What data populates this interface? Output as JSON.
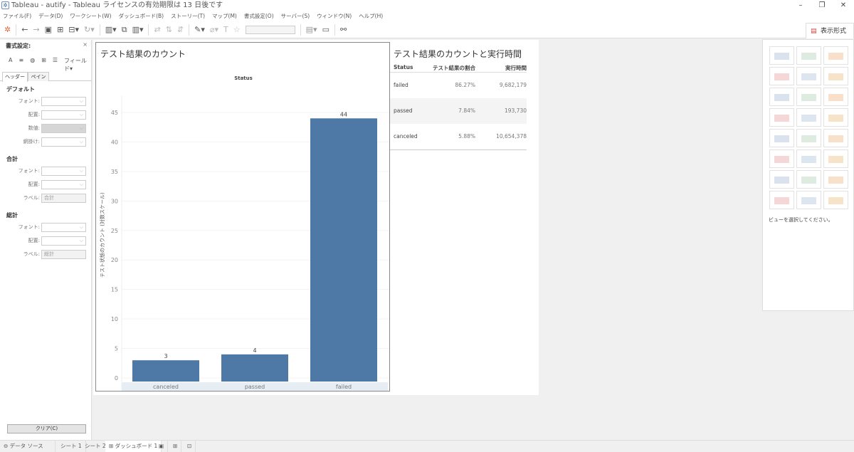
{
  "window": {
    "title": "Tableau - autify - Tableau ライセンスの有効期限は 13 日後です",
    "controls": [
      "–",
      "❐",
      "✕"
    ]
  },
  "menu": [
    "ファイル(F)",
    "データ(D)",
    "ワークシート(W)",
    "ダッシュボード(B)",
    "ストーリー(T)",
    "マップ(M)",
    "書式設定(O)",
    "サーバー(S)",
    "ウィンドウ(N)",
    "ヘルプ(H)"
  ],
  "format_panel": {
    "title": "書式設定:",
    "close": "×",
    "field_menu": "フィールド▾",
    "tabs": [
      "ヘッダー",
      "ペイン"
    ],
    "sections": [
      {
        "title": "デフォルト",
        "rows": [
          {
            "label": "フォント:",
            "value": ""
          },
          {
            "label": "配置:",
            "value": ""
          },
          {
            "label": "数値:",
            "value": ""
          },
          {
            "label": "網掛け:",
            "value": ""
          }
        ]
      },
      {
        "title": "合計",
        "rows": [
          {
            "label": "フォント:",
            "value": ""
          },
          {
            "label": "配置:",
            "value": ""
          },
          {
            "label": "ラベル:",
            "value": "合計"
          }
        ]
      },
      {
        "title": "総計",
        "rows": [
          {
            "label": "フォント:",
            "value": ""
          },
          {
            "label": "配置:",
            "value": ""
          },
          {
            "label": "ラベル:",
            "value": "総計"
          }
        ]
      }
    ],
    "clear_button": "クリア(C)"
  },
  "chart_data": {
    "type": "bar",
    "title": "テスト結果のカウント",
    "column_header": "Status",
    "categories": [
      "canceled",
      "passed",
      "failed"
    ],
    "values": [
      3,
      4,
      44
    ],
    "ylabel": "テスト状態のカウント (対数スケール)",
    "yticks": [
      0,
      5,
      10,
      15,
      20,
      25,
      30,
      35,
      40,
      45
    ],
    "ylim": [
      0,
      45
    ],
    "bar_color": "#4e79a7"
  },
  "table": {
    "title": "テスト結果のカウントと実行時間",
    "headers": [
      "Status",
      "テスト結果の割合",
      "実行時間"
    ],
    "rows": [
      [
        "failed",
        "86.27%",
        "9,682,179"
      ],
      [
        "passed",
        "7.84%",
        "193,730"
      ],
      [
        "canceled",
        "5.88%",
        "10,654,378"
      ]
    ]
  },
  "show_me": {
    "tab": "表示形式",
    "hint": "ビューを選択してください。"
  },
  "bottom_tabs": [
    "データ ソース",
    "シート 1",
    "シート 2",
    "ダッシュボード 1"
  ]
}
